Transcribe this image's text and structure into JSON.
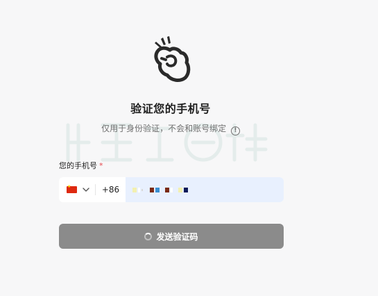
{
  "header": {
    "title": "验证您的手机号",
    "subtitle": "仅用于身份验证，不会和账号绑定"
  },
  "form": {
    "phone_label": "您的手机号",
    "required_mark": "*",
    "country_flag_icon": "china-flag-icon",
    "dial_code": "+86",
    "send_button_label": "发送验证码"
  },
  "watermark": {
    "text": "百度百科"
  },
  "colors": {
    "button_bg": "#8b8b8b",
    "input_bg": "#e8f0fe",
    "required": "#e5484d"
  }
}
